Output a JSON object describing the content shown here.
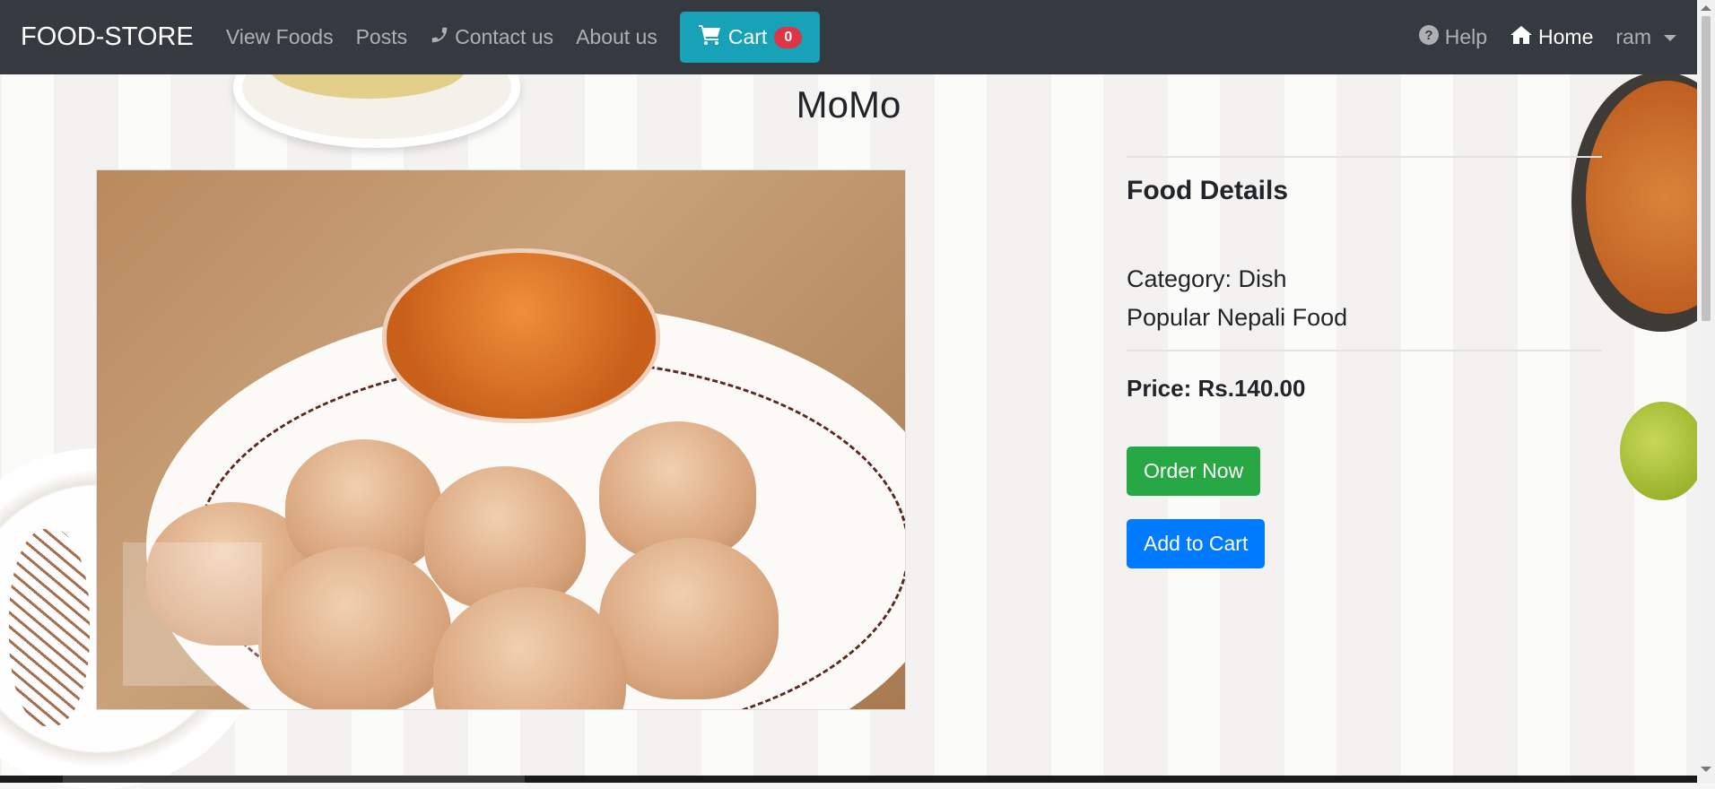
{
  "navbar": {
    "brand": "FOOD-STORE",
    "links": {
      "view_foods": "View Foods",
      "posts": "Posts",
      "contact": "Contact us",
      "about": "About us"
    },
    "cart": {
      "label": "Cart",
      "count": "0"
    },
    "right": {
      "help": "Help",
      "home": "Home",
      "user": "ram"
    }
  },
  "food": {
    "name": "MoMo",
    "details_heading": "Food Details",
    "category": "Category: Dish",
    "description": "Popular Nepali Food",
    "price": "Price: Rs.140.00",
    "order_label": "Order Now",
    "add_cart_label": "Add to Cart"
  },
  "icons": {
    "contact": "phone-icon",
    "cart": "shopping-cart-icon",
    "help": "question-circle-icon",
    "home": "home-icon",
    "user_menu": "caret-down-icon"
  },
  "colors": {
    "navbar": "#343a40",
    "cart_button": "#17a2b8",
    "badge": "#dc3545",
    "order_button": "#28a745",
    "add_cart_button": "#007bff"
  }
}
